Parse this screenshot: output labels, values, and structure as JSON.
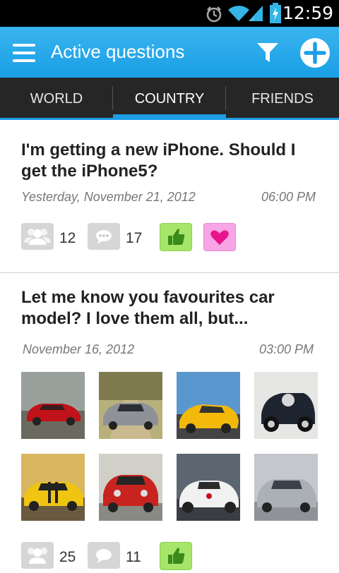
{
  "status": {
    "time": "12:59"
  },
  "header": {
    "title": "Active questions"
  },
  "tabs": [
    {
      "label": "WORLD",
      "active": false
    },
    {
      "label": "COUNTRY",
      "active": true
    },
    {
      "label": "FRIENDS",
      "active": false
    }
  ],
  "posts": [
    {
      "question": "I'm getting a new iPhone. Should I get the iPhone5?",
      "date": "Yesterday, November 21, 2012",
      "time": "06:00 PM",
      "people_count": "12",
      "comment_count": "17"
    },
    {
      "question": "Let me know you favourites car model? I love them all, but...",
      "date": "November 16, 2012",
      "time": "03:00 PM",
      "people_count": "25",
      "comment_count": "11",
      "images": [
        "red-sports-car",
        "silver-coupe",
        "yellow-supercar",
        "vintage-black-car",
        "yellow-muscle-car",
        "red-classic-bmw",
        "white-concept-car",
        "silver-luxury-sedan"
      ]
    }
  ],
  "colors": {
    "accent": "#1d9ee6",
    "like": "#a6e46a",
    "heart": "#f7a5e6",
    "heart_icon": "#e8148c"
  }
}
